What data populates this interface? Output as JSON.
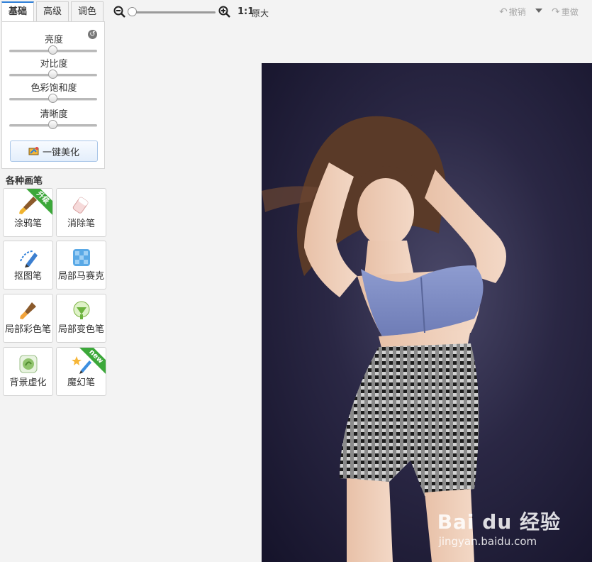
{
  "tabs": [
    {
      "label": "基础",
      "active": true
    },
    {
      "label": "高级",
      "active": false
    },
    {
      "label": "调色",
      "active": false
    }
  ],
  "adjustments": [
    {
      "label": "亮度",
      "value": 0.5
    },
    {
      "label": "对比度",
      "value": 0.5
    },
    {
      "label": "色彩饱和度",
      "value": 0.5
    },
    {
      "label": "清晰度",
      "value": 0.5
    }
  ],
  "beautify_label": "一键美化",
  "brushes_title": "各种画笔",
  "brushes": [
    {
      "label": "涂鸦笔",
      "icon": "brush-icon",
      "ribbon": "升级"
    },
    {
      "label": "消除笔",
      "icon": "eraser-icon",
      "ribbon": ""
    },
    {
      "label": "抠图笔",
      "icon": "cutout-pen-icon",
      "ribbon": ""
    },
    {
      "label": "局部马赛克",
      "icon": "mosaic-icon",
      "ribbon": ""
    },
    {
      "label": "局部彩色笔",
      "icon": "color-brush-icon",
      "ribbon": ""
    },
    {
      "label": "局部变色笔",
      "icon": "color-change-icon",
      "ribbon": ""
    },
    {
      "label": "背景虚化",
      "icon": "background-blur-icon",
      "ribbon": ""
    },
    {
      "label": "魔幻笔",
      "icon": "magic-pen-icon",
      "ribbon": "new"
    }
  ],
  "toolbar": {
    "zoom_level": 0,
    "ratio_label": "1:1",
    "original_label": "原大",
    "undo_label": "撤销",
    "redo_label": "重做"
  },
  "watermark": {
    "brand": "Bai du 经验",
    "url": "jingyan.baidu.com"
  },
  "colors": {
    "accent": "#2e7fd8",
    "ribbon": "#3ca83a",
    "photo_background": "#2a2744"
  }
}
